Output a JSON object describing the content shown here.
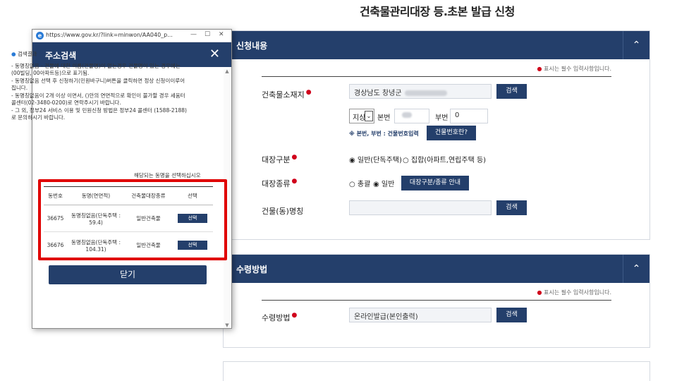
{
  "page": {
    "title": "건축물관리대장 등.초본 발급 신청"
  },
  "section1": {
    "title": "신청내용",
    "collapse_icon": "chevron-up",
    "required_note": "표시는 필수 입력사항입니다.",
    "address": {
      "label": "건축물소재지",
      "value": "경상남도 창녕군",
      "search_label": "검색"
    },
    "lot": {
      "select_value": "지상",
      "bonbeon_label": "본번",
      "bubeon_label": "부번",
      "bubeon_value": "0"
    },
    "help_text": "※ 본번, 부번 : 건물번호입력",
    "building_no_button": "건물번호란?",
    "register_type": {
      "label": "대장구분",
      "option1": "일반(단독주택)",
      "option2": "집합(아파트,연립주택 등)",
      "selected": "일반(단독주택)"
    },
    "register_kind": {
      "label": "대장종류",
      "option1": "총괄",
      "option2": "일반",
      "selected": "일반",
      "guide_button": "대장구분/종류 안내"
    },
    "building_name": {
      "label": "건물(동)명칭",
      "search_label": "검색"
    }
  },
  "section2": {
    "title": "수령방법",
    "collapse_icon": "chevron-up",
    "required_note": "표시는 필수 입력사항입니다.",
    "receive": {
      "label": "수령방법",
      "value": "온라인발급(본인출력)",
      "search_label": "검색"
    }
  },
  "popup": {
    "url": "https://www.gov.kr/?link=minwon/AA040_p...",
    "title": "주소검색",
    "close_icon": "close",
    "result_heading": "검색결과",
    "notes": [
      "- 동명칭없음 - 건물에 대한 이름(건물명)이 없는경우 건물명이 있는 경우에는 (00빌딩, 00아파트등)으로 표기됨.",
      "- 동명칭없음 선택 후 신청하기(민원바구니)버튼을 클릭하면 정상 신청이이루어집니다.",
      "- 동명칭없음이 2개 이상 이면서, ()안의 연면적으로 확인이 불가할 경우 세움터 콜센터(02-3480-0200)로 연락주시기 바랍니다.",
      "- 그 외, 정부24 서비스 이용 및 민원신청 방법은 정부24 콜센터 (1588-2188)로 문의하시기 바랍니다."
    ],
    "hint": "해당되는 동명을 선택하십시오",
    "table": {
      "headers": [
        "동번호",
        "동명(연면적)",
        "건축물대장종류",
        "선택"
      ],
      "rows": [
        {
          "no": "36675",
          "name": "동명칭없음(단독주택 : 59.4)",
          "kind": "일반건축물",
          "select": "선택"
        },
        {
          "no": "36676",
          "name": "동명칭없음(단독주택 : 104.31)",
          "kind": "일반건축물",
          "select": "선택"
        }
      ]
    },
    "close_button": "닫기"
  }
}
